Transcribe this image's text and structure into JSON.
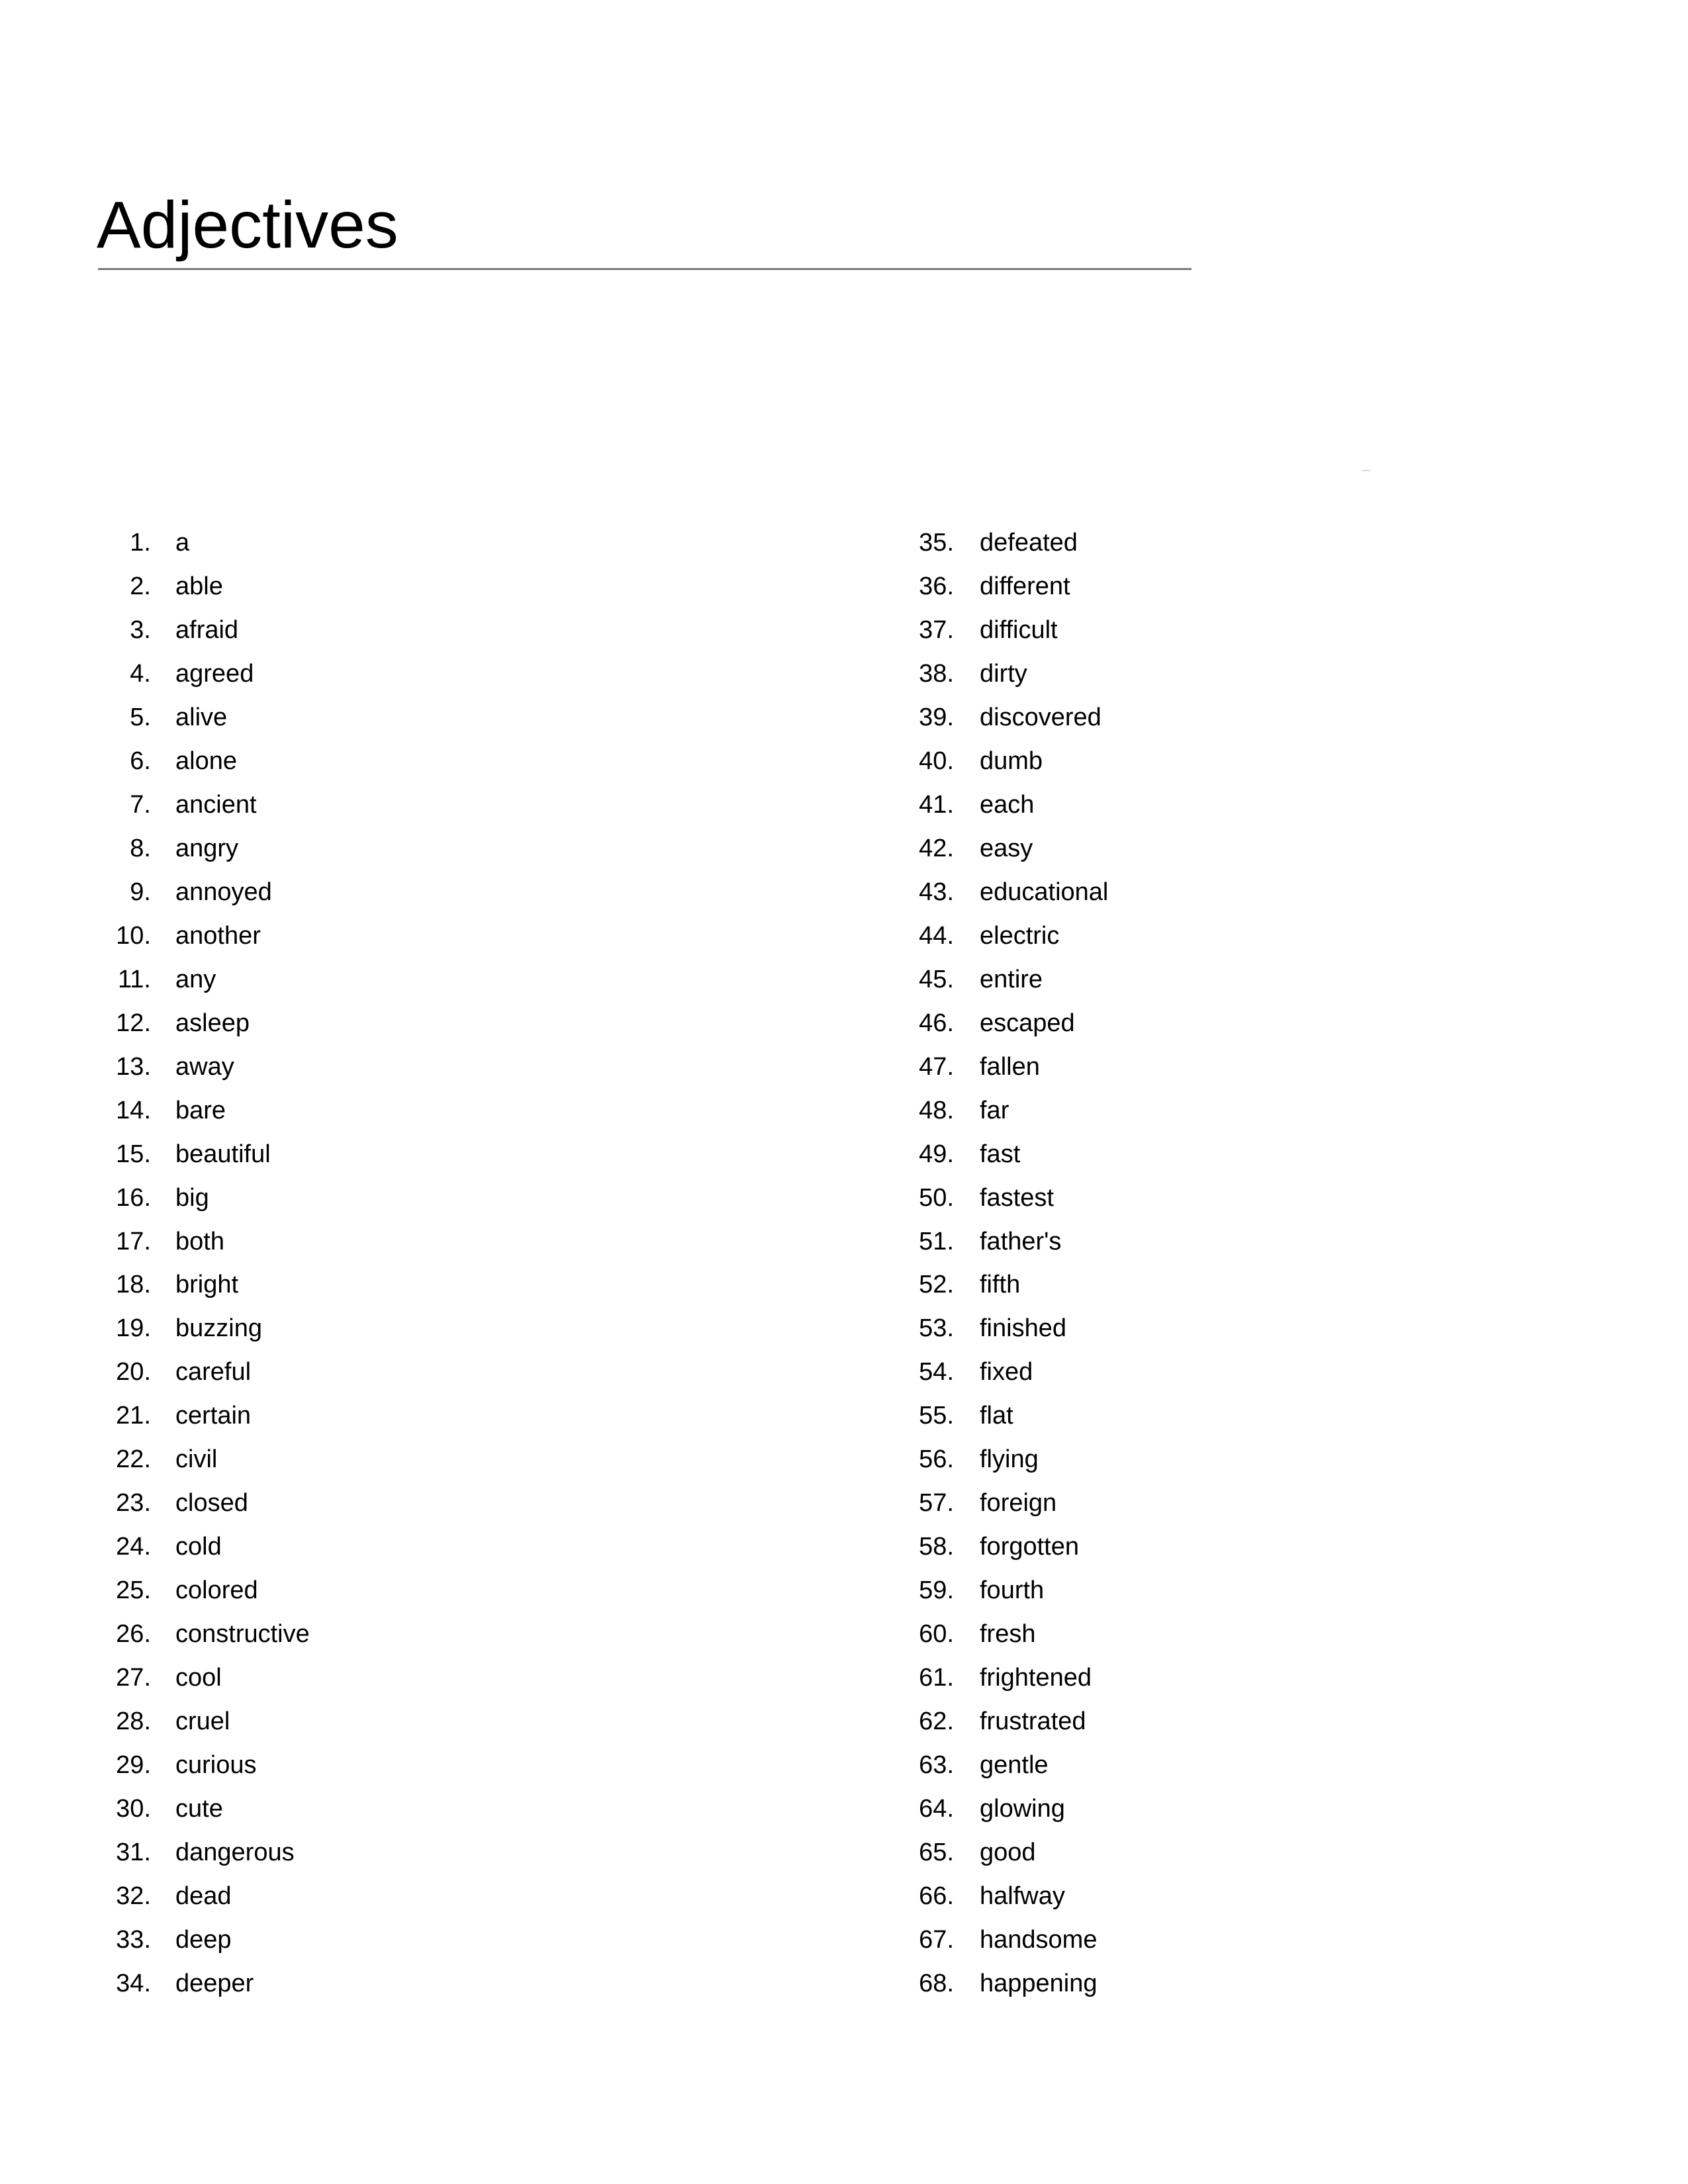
{
  "title": "Adjectives",
  "column1": [
    {
      "num": "1.",
      "word": "a"
    },
    {
      "num": "2.",
      "word": "able"
    },
    {
      "num": "3.",
      "word": "afraid"
    },
    {
      "num": "4.",
      "word": "agreed"
    },
    {
      "num": "5.",
      "word": "alive"
    },
    {
      "num": "6.",
      "word": "alone"
    },
    {
      "num": "7.",
      "word": "ancient"
    },
    {
      "num": "8.",
      "word": "angry"
    },
    {
      "num": "9.",
      "word": "annoyed"
    },
    {
      "num": "10.",
      "word": "another"
    },
    {
      "num": "11.",
      "word": "any"
    },
    {
      "num": "12.",
      "word": "asleep"
    },
    {
      "num": "13.",
      "word": "away"
    },
    {
      "num": "14.",
      "word": "bare"
    },
    {
      "num": "15.",
      "word": "beautiful"
    },
    {
      "num": "16.",
      "word": "big"
    },
    {
      "num": "17.",
      "word": "both"
    },
    {
      "num": "18.",
      "word": "bright"
    },
    {
      "num": "19.",
      "word": "buzzing"
    },
    {
      "num": "20.",
      "word": "careful"
    },
    {
      "num": "21.",
      "word": "certain"
    },
    {
      "num": "22.",
      "word": "civil"
    },
    {
      "num": "23.",
      "word": "closed"
    },
    {
      "num": "24.",
      "word": "cold"
    },
    {
      "num": "25.",
      "word": "colored"
    },
    {
      "num": "26.",
      "word": "constructive"
    },
    {
      "num": "27.",
      "word": "cool"
    },
    {
      "num": "28.",
      "word": "cruel"
    },
    {
      "num": "29.",
      "word": "curious"
    },
    {
      "num": "30.",
      "word": "cute"
    },
    {
      "num": "31.",
      "word": "dangerous"
    },
    {
      "num": "32.",
      "word": "dead"
    },
    {
      "num": "33.",
      "word": "deep"
    },
    {
      "num": "34.",
      "word": "deeper"
    }
  ],
  "column2": [
    {
      "num": "35.",
      "word": "defeated"
    },
    {
      "num": "36.",
      "word": "different"
    },
    {
      "num": "37.",
      "word": "difficult"
    },
    {
      "num": "38.",
      "word": "dirty"
    },
    {
      "num": "39.",
      "word": "discovered"
    },
    {
      "num": "40.",
      "word": "dumb"
    },
    {
      "num": "41.",
      "word": "each"
    },
    {
      "num": "42.",
      "word": "easy"
    },
    {
      "num": "43.",
      "word": "educational"
    },
    {
      "num": "44.",
      "word": "electric"
    },
    {
      "num": "45.",
      "word": "entire"
    },
    {
      "num": "46.",
      "word": "escaped"
    },
    {
      "num": "47.",
      "word": "fallen"
    },
    {
      "num": "48.",
      "word": "far"
    },
    {
      "num": "49.",
      "word": "fast"
    },
    {
      "num": "50.",
      "word": "fastest"
    },
    {
      "num": "51.",
      "word": "father's"
    },
    {
      "num": "52.",
      "word": "fifth"
    },
    {
      "num": "53.",
      "word": "finished"
    },
    {
      "num": "54.",
      "word": "fixed"
    },
    {
      "num": "55.",
      "word": "flat"
    },
    {
      "num": "56.",
      "word": "flying"
    },
    {
      "num": "57.",
      "word": "foreign"
    },
    {
      "num": "58.",
      "word": "forgotten"
    },
    {
      "num": "59.",
      "word": "fourth"
    },
    {
      "num": "60.",
      "word": "fresh"
    },
    {
      "num": "61.",
      "word": "frightened"
    },
    {
      "num": "62.",
      "word": "frustrated"
    },
    {
      "num": "63.",
      "word": "gentle"
    },
    {
      "num": "64.",
      "word": "glowing"
    },
    {
      "num": "65.",
      "word": "good"
    },
    {
      "num": "66.",
      "word": "halfway"
    },
    {
      "num": "67.",
      "word": "handsome"
    },
    {
      "num": "68.",
      "word": "happening"
    }
  ]
}
